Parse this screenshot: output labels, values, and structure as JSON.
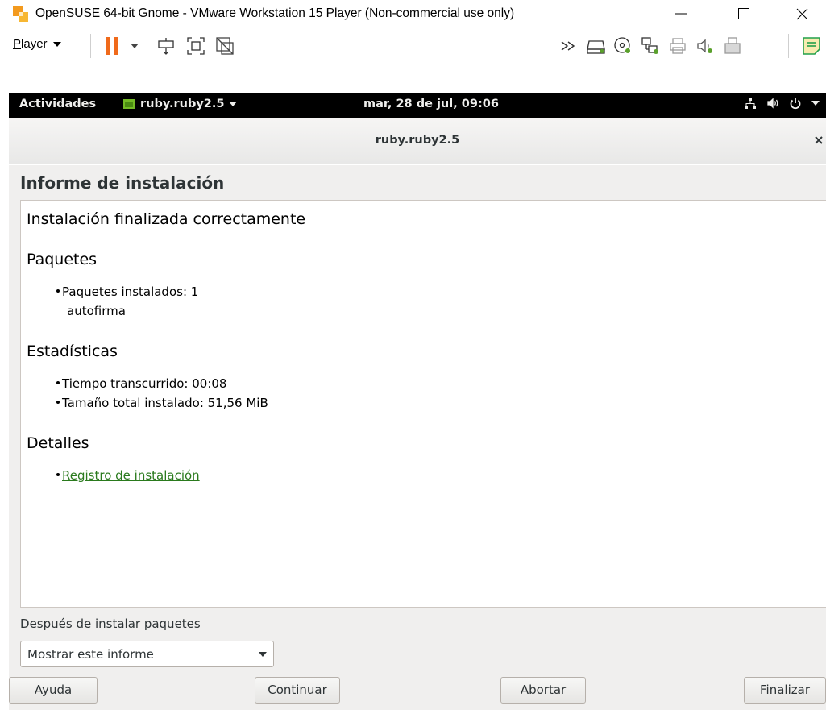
{
  "window": {
    "title": "OpenSUSE 64-bit Gnome - VMware Workstation 15 Player (Non-commercial use only)"
  },
  "toolbar": {
    "player_label_underlined": "P",
    "player_label_rest": "layer"
  },
  "gnome": {
    "activities": "Actividades",
    "app_menu": "ruby.ruby2.5",
    "clock": "mar, 28 de jul, 09:06"
  },
  "app": {
    "header_title": "ruby.ruby2.5",
    "section_title": "Informe de instalación",
    "report": {
      "main_heading": "Instalación finalizada correctamente",
      "packages_heading": "Paquetes",
      "packages_installed": "Paquetes instalados: 1",
      "package_name": "autofirma",
      "stats_heading": "Estadísticas",
      "elapsed_time": "Tiempo transcurrido: 00:08",
      "total_size": "Tamaño total instalado: 51,56 MiB",
      "details_heading": "Detalles",
      "install_log_link": "Registro de instalación"
    },
    "after_install_label_u": "D",
    "after_install_label_rest": "espués de instalar paquetes",
    "after_install_value": "Mostrar este informe",
    "buttons": {
      "help_a": "Ay",
      "help_u": "u",
      "help_b": "da",
      "continue_u": "C",
      "continue_rest": "ontinuar",
      "abort_a": "Aborta",
      "abort_u": "r",
      "finish_u": "F",
      "finish_rest": "inalizar"
    }
  }
}
